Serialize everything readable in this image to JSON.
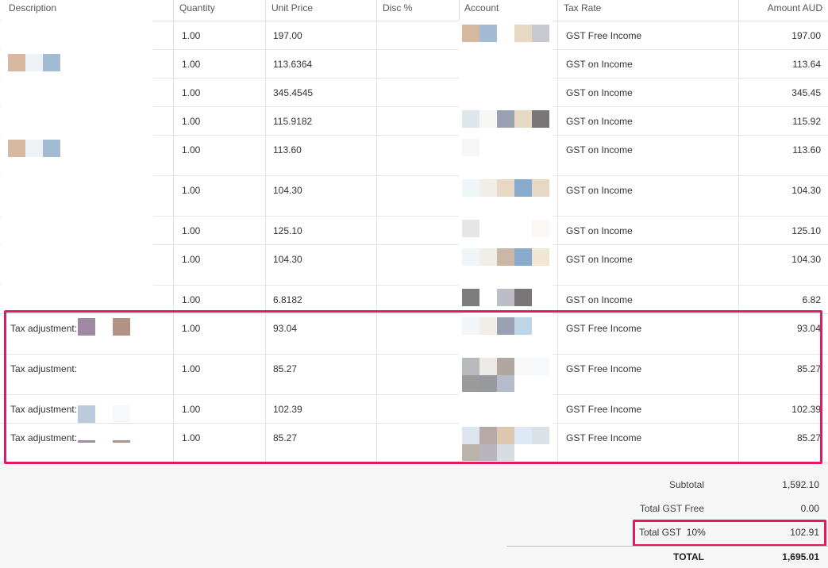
{
  "columns": {
    "description": "Description",
    "quantity": "Quantity",
    "unit_price": "Unit Price",
    "disc": "Disc %",
    "account": "Account",
    "tax_rate": "Tax Rate",
    "amount": "Amount AUD"
  },
  "rows": [
    {
      "desc": "",
      "qty": "1.00",
      "price": "197.00",
      "tax": "GST Free Income",
      "amount": "197.00"
    },
    {
      "desc": "",
      "qty": "1.00",
      "price": "113.6364",
      "tax": "GST on Income",
      "amount": "113.64"
    },
    {
      "desc": "",
      "qty": "1.00",
      "price": "345.4545",
      "tax": "GST on Income",
      "amount": "345.45"
    },
    {
      "desc": "",
      "qty": "1.00",
      "price": "115.9182",
      "tax": "GST on Income",
      "amount": "115.92"
    },
    {
      "desc": "",
      "qty": "1.00",
      "price": "113.60",
      "tax": "GST on Income",
      "amount": "113.60"
    },
    {
      "desc": "",
      "qty": "1.00",
      "price": "104.30",
      "tax": "GST on Income",
      "amount": "104.30"
    },
    {
      "desc": "",
      "qty": "1.00",
      "price": "125.10",
      "tax": "GST on Income",
      "amount": "125.10"
    },
    {
      "desc": "",
      "qty": "1.00",
      "price": "104.30",
      "tax": "GST on Income",
      "amount": "104.30"
    },
    {
      "desc": "",
      "qty": "1.00",
      "price": "6.8182",
      "tax": "GST on Income",
      "amount": "6.82"
    },
    {
      "desc": "Tax adjustment:",
      "qty": "1.00",
      "price": "93.04",
      "tax": "GST Free Income",
      "amount": "93.04"
    },
    {
      "desc": "Tax adjustment:",
      "qty": "1.00",
      "price": "85.27",
      "tax": "GST Free Income",
      "amount": "85.27"
    },
    {
      "desc": "Tax adjustment:",
      "qty": "1.00",
      "price": "102.39",
      "tax": "GST Free Income",
      "amount": "102.39"
    },
    {
      "desc": "Tax adjustment:",
      "qty": "1.00",
      "price": "85.27",
      "tax": "GST Free Income",
      "amount": "85.27"
    }
  ],
  "totals": {
    "subtotal_label": "Subtotal",
    "subtotal_value": "1,592.10",
    "gst_free_label": "Total GST Free",
    "gst_free_value": "0.00",
    "gst_label": "Total GST  10%",
    "gst_value": "102.91",
    "total_label": "TOTAL",
    "total_value": "1,695.01"
  },
  "colors": {
    "highlight": "#e5195e",
    "redaction": [
      "#d6b9a0",
      "#a3bcd3",
      "#c7c9d1",
      "#9aa1b3",
      "#7a7677",
      "#e7d8c4",
      "#a08aa3",
      "#b39184",
      "#bccbdc"
    ]
  }
}
